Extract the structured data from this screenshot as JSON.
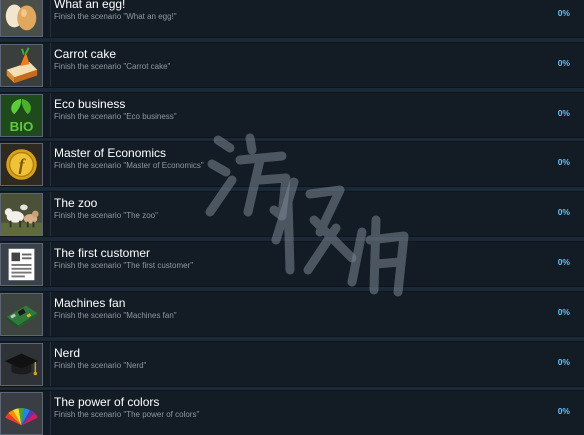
{
  "achievements": [
    {
      "title": "What an egg!",
      "description": "Finish the scenario \"What an egg!\"",
      "percent": "0%",
      "icon": "egg-icon"
    },
    {
      "title": "Carrot cake",
      "description": "Finish the scenario \"Carrot cake\"",
      "percent": "0%",
      "icon": "carrot-cake-icon"
    },
    {
      "title": "Eco business",
      "description": "Finish the scenario \"Eco business\"",
      "percent": "0%",
      "icon": "bio-leaf-icon"
    },
    {
      "title": "Master of Economics",
      "description": "Finish the scenario \"Master of Economics\"",
      "percent": "0%",
      "icon": "gold-coin-icon"
    },
    {
      "title": "The zoo",
      "description": "Finish the scenario \"The zoo\"",
      "percent": "0%",
      "icon": "farm-animals-icon"
    },
    {
      "title": "The first customer",
      "description": "Finish the scenario \"The first customer\"",
      "percent": "0%",
      "icon": "document-icon"
    },
    {
      "title": "Machines fan",
      "description": "Finish the scenario \"Machines fan\"",
      "percent": "0%",
      "icon": "circuit-board-icon"
    },
    {
      "title": "Nerd",
      "description": "Finish the scenario \"Nerd\"",
      "percent": "0%",
      "icon": "graduation-cap-icon"
    },
    {
      "title": "The power of colors",
      "description": "Finish the scenario \"The power of colors\"",
      "percent": "0%",
      "icon": "color-fan-icon"
    }
  ],
  "colors": {
    "background": "#1b2838",
    "row": "#131c25",
    "percent": "#66c0f4",
    "description": "#8f98a0"
  }
}
